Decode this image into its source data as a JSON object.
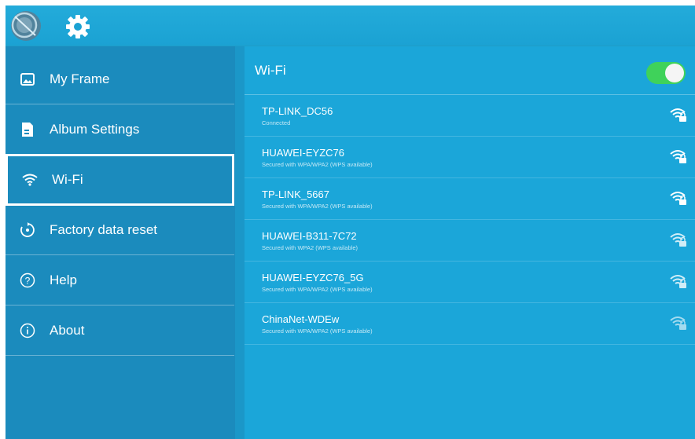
{
  "topbar": {
    "logo_icon": "frame-logo-icon",
    "settings_icon": "gear-icon"
  },
  "sidebar": {
    "items": [
      {
        "label": "My Frame",
        "icon": "picture-icon"
      },
      {
        "label": "Album Settings",
        "icon": "document-icon"
      },
      {
        "label": "Wi-Fi",
        "icon": "wifi-icon",
        "selected": true
      },
      {
        "label": "Factory data reset",
        "icon": "reset-icon"
      },
      {
        "label": "Help",
        "icon": "help-icon"
      },
      {
        "label": "About",
        "icon": "info-icon"
      }
    ]
  },
  "main": {
    "title": "Wi-Fi",
    "toggle_on": true,
    "toggle_color": "#3fd25a",
    "networks": [
      {
        "name": "TP-LINK_DC56",
        "status": "Connected",
        "icon": "wifi-lock-icon"
      },
      {
        "name": "HUAWEI-EYZC76",
        "status": "Secured with WPA/WPA2 (WPS available)",
        "icon": "wifi-lock-icon"
      },
      {
        "name": "TP-LINK_5667",
        "status": "Secured with WPA/WPA2 (WPS available)",
        "icon": "wifi-lock-icon"
      },
      {
        "name": "HUAWEI-B311-7C72",
        "status": "Secured with WPA2 (WPS available)",
        "icon": "wifi-lock-icon"
      },
      {
        "name": "HUAWEI-EYZC76_5G",
        "status": "Secured with WPA/WPA2 (WPS available)",
        "icon": "wifi-lock-icon"
      },
      {
        "name": "ChinaNet-WDEw",
        "status": "Secured with WPA/WPA2 (WPS available)",
        "icon": "wifi-lock-icon"
      }
    ]
  },
  "colors": {
    "background": "#1a9fcf",
    "sidebar": "#1b8bbd",
    "main": "#1ba6d9"
  }
}
